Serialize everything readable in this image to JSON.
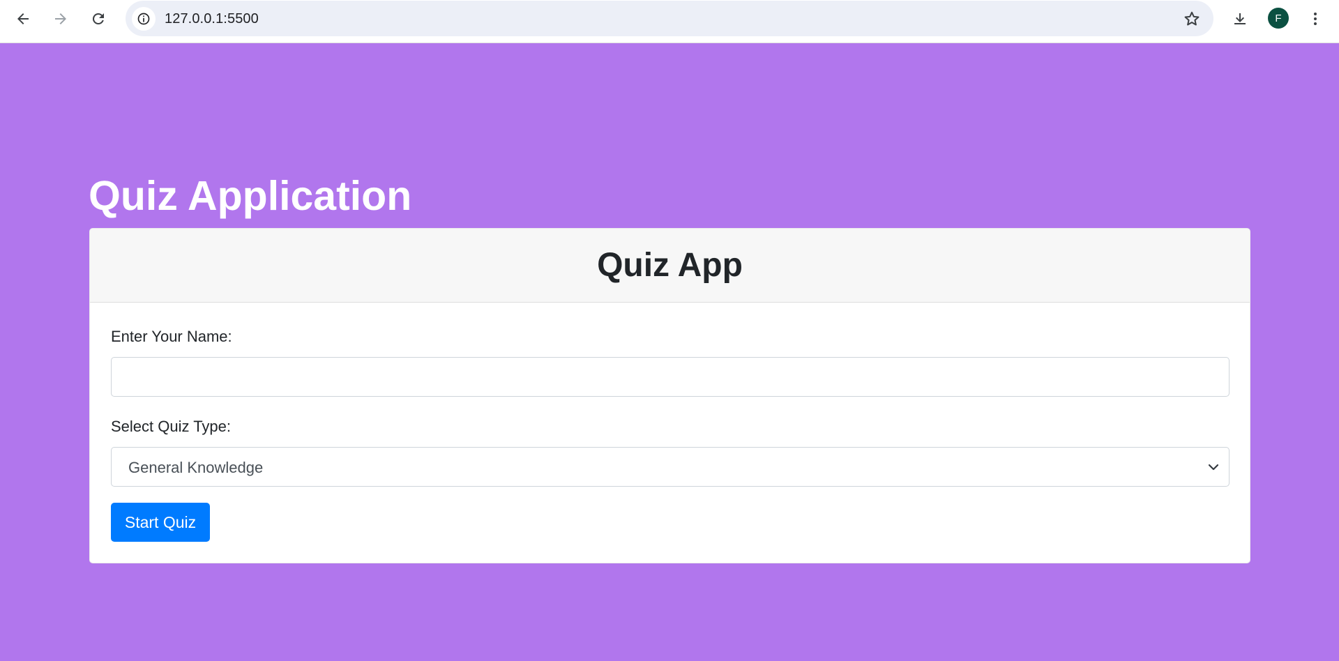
{
  "browser": {
    "url": "127.0.0.1:5500",
    "profile_initial": "F",
    "profile_color": "#0b5041"
  },
  "page": {
    "heading": "Quiz Application",
    "background_color": "#b176ed"
  },
  "card": {
    "title": "Quiz App",
    "name_label": "Enter Your Name:",
    "name_value": "",
    "quiz_type_label": "Select Quiz Type:",
    "quiz_type_selected": "General Knowledge",
    "start_button_label": "Start Quiz",
    "button_color": "#007bff"
  },
  "icons": {
    "back": "arrow-left-icon",
    "forward": "arrow-right-icon",
    "reload": "reload-icon",
    "site_info": "info-icon",
    "bookmark": "star-icon",
    "download": "download-icon",
    "menu": "kebab-menu-icon",
    "select_arrow": "chevron-down-icon"
  }
}
